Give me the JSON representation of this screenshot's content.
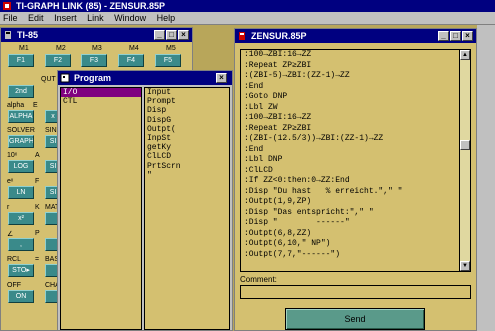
{
  "app": {
    "title": "TI-GRAPH LINK (85) - ZENSUR.85P",
    "menu": [
      "File",
      "Edit",
      "Insert",
      "Link",
      "Window",
      "Help"
    ]
  },
  "calc_window": {
    "title": "TI-85",
    "fkey_labels": [
      "M1",
      "M2",
      "M3",
      "M4",
      "M5"
    ],
    "fkeys": [
      "F1",
      "F2",
      "F3",
      "F4",
      "F5"
    ],
    "left_rows": [
      {
        "above": "",
        "key": "2nd"
      },
      {
        "above": "alpha",
        "key": "ALPHA"
      },
      {
        "above": "SOLVER",
        "key": "GRAPH"
      },
      {
        "above": "10ˣ",
        "key": "LOG"
      },
      {
        "above": "eˣ",
        "key": "LN"
      },
      {
        "above": "r",
        "key": "x²"
      },
      {
        "above": "∠",
        "key": ","
      },
      {
        "above": "RCL",
        "key": "STO▸"
      },
      {
        "above": "OFF",
        "key": "ON"
      }
    ],
    "second_col": [
      {
        "above": "",
        "key": "E"
      },
      {
        "above": "",
        "key": "x"
      },
      {
        "above": "SIN",
        "key": "SI"
      },
      {
        "above": "A",
        "key": "SI"
      },
      {
        "above": "F",
        "key": "SI"
      },
      {
        "above": "K",
        "key": "MAT"
      },
      {
        "above": "P",
        "key": ""
      },
      {
        "above": "=",
        "key": "BAS"
      },
      {
        "above": "",
        "key": "CHA"
      }
    ],
    "misc_labels": [
      "QUT",
      "E",
      "F"
    ]
  },
  "program_window": {
    "title": "Program",
    "categories": [
      "I/O",
      "CTL"
    ],
    "commands": [
      "Input",
      "Prompt",
      "Disp",
      "DispG",
      "Outpt(",
      "InpSt",
      "getKy",
      "ClLCD",
      "PrtScrn",
      "\""
    ]
  },
  "editor_window": {
    "title": "ZENSUR.85P",
    "code_lines": [
      ":100→ZBI:16→ZZ",
      ":Repeat ZP≥ZBI",
      ":(ZBI-5)→ZBI:(ZZ-1)→ZZ",
      ":End",
      ":Goto DNP",
      ":Lbl ZW",
      ":100→ZBI:16→ZZ",
      ":Repeat ZP≥ZBI",
      ":(ZBI-(12.5/3))→ZBI:(ZZ-1)→ZZ",
      ":End",
      ":Lbl DNP",
      ":ClLCD",
      ":If ZZ<0:then:0→ZZ:End",
      ":Disp \"Du hast   % erreicht.\",\" \"",
      ":Outpt(1,9,ZP)",
      ":Disp \"Das entspricht:\",\" \"",
      ":Disp \"        ------\"",
      ":Outpt(6,8,ZZ)",
      ":Outpt(6,10,\" NP\")",
      ":Outpt(7,7,\"------\")"
    ],
    "comment_label": "Comment:",
    "comment_value": "",
    "send_label": "Send"
  }
}
